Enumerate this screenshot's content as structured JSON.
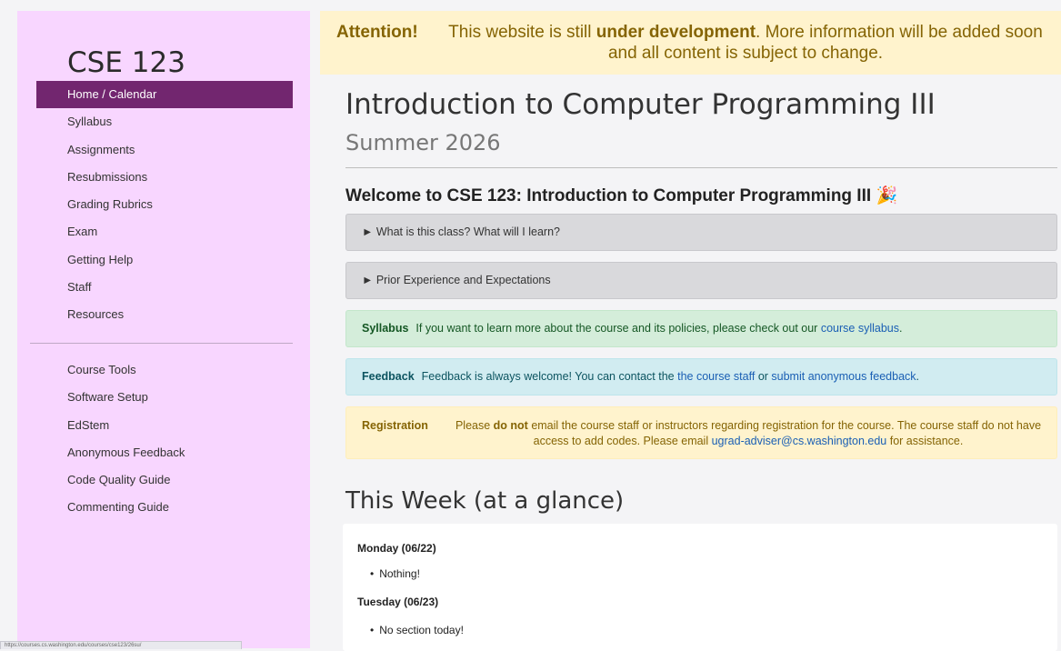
{
  "sidebar": {
    "course_title": "CSE 123",
    "items": [
      {
        "label": "Home / Calendar",
        "active": true
      },
      {
        "label": "Syllabus"
      },
      {
        "label": "Assignments"
      },
      {
        "label": "Resubmissions"
      },
      {
        "label": "Grading Rubrics"
      },
      {
        "label": "Exam"
      },
      {
        "label": "Getting Help"
      },
      {
        "label": "Staff"
      },
      {
        "label": "Resources"
      }
    ],
    "tools": [
      {
        "label": "Course Tools"
      },
      {
        "label": "Software Setup"
      },
      {
        "label": "EdStem"
      },
      {
        "label": "Anonymous Feedback"
      },
      {
        "label": "Code Quality Guide"
      },
      {
        "label": "Commenting Guide"
      }
    ],
    "status_url": "https://courses.cs.washington.edu/courses/cse123/26su/"
  },
  "banner": {
    "label": "Attention!",
    "text_pre": "This website is still ",
    "text_bold": "under development",
    "text_post": ". More information will be added soon and all content is subject to change."
  },
  "main": {
    "title": "Introduction to Computer Programming III",
    "subtitle": "Summer 2026",
    "welcome": "Welcome to CSE 123: Introduction to Computer Programming III",
    "welcome_emoji": "🎉",
    "details": [
      {
        "summary": "► What is this class? What will I learn?"
      },
      {
        "summary": "► Prior Experience and Expectations"
      }
    ],
    "syllabus_alert": {
      "label": "Syllabus",
      "text": "If you want to learn more about the course and its policies, please check out our ",
      "link": "course syllabus",
      "end": "."
    },
    "feedback_alert": {
      "label": "Feedback",
      "text": "Feedback is always welcome! You can contact the ",
      "link1": "the course staff",
      "mid": " or ",
      "link2": "submit anonymous feedback",
      "end": "."
    },
    "registration_alert": {
      "label": "Registration",
      "pre": "Please ",
      "bold": "do not",
      "text": " email the course staff or instructors regarding registration for the course. The course staff do not have access to add codes. Please email ",
      "email": "ugrad-adviser@cs.washington.edu",
      "end": " for assistance."
    },
    "week_title": "This Week (at a glance)",
    "week": [
      {
        "day": "Monday (06/22)",
        "items": [
          "Nothing!"
        ]
      },
      {
        "day": "Tuesday (06/23)",
        "items": [
          "No section today!"
        ]
      }
    ]
  },
  "colors": {
    "sidebar_bg": "#f8d6ff",
    "active_bg": "#72266f",
    "banner_bg": "#fff3cd",
    "link": "#1a5fb4"
  }
}
